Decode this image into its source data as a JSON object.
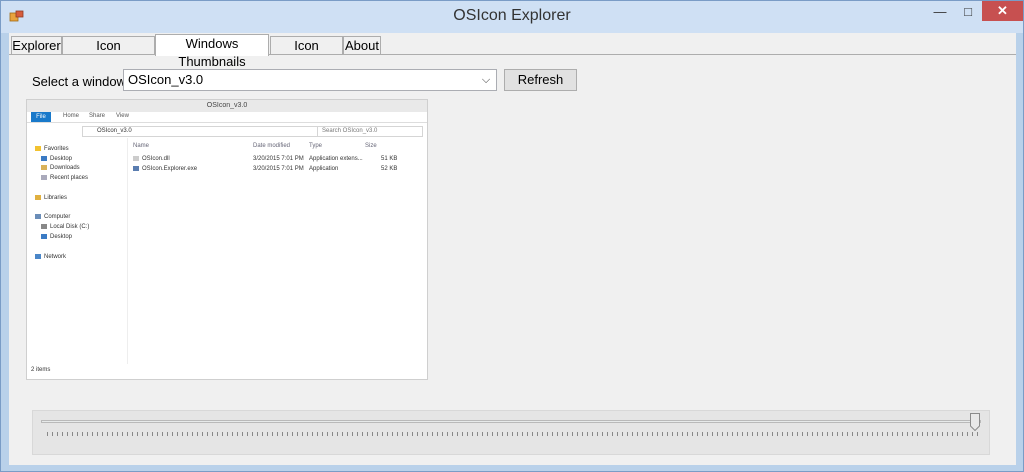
{
  "window": {
    "title": "OSIcon Explorer"
  },
  "tabs": [
    {
      "label": "Explorer"
    },
    {
      "label": "Icon Associations"
    },
    {
      "label": "Windows Thumbnails"
    },
    {
      "label": "Icon Explorer"
    },
    {
      "label": "About"
    }
  ],
  "panel": {
    "select_label": "Select a window:",
    "selected_window": "OSIcon_v3.0",
    "refresh_label": "Refresh"
  },
  "thumbnail": {
    "title": "OSIcon_v3.0",
    "ribbon": [
      "File",
      "Home",
      "Share",
      "View"
    ],
    "address": "OSIcon_v3.0",
    "search_placeholder": "Search OSIcon_v3.0",
    "nav": {
      "favorites": "Favorites",
      "desktop": "Desktop",
      "downloads": "Downloads",
      "recent": "Recent places",
      "libraries": "Libraries",
      "computer": "Computer",
      "local_disk": "Local Disk (C:)",
      "desktop2": "Desktop",
      "network": "Network"
    },
    "columns": [
      "Name",
      "Date modified",
      "Type",
      "Size"
    ],
    "files": [
      {
        "name": "OSIcon.dll",
        "date": "3/20/2015 7:01 PM",
        "type": "Application extens...",
        "size": "51 KB"
      },
      {
        "name": "OSIcon.Explorer.exe",
        "date": "3/20/2015 7:01 PM",
        "type": "Application",
        "size": "52 KB"
      }
    ],
    "status": "2 items"
  },
  "slider": {
    "value_fraction": 1.0
  },
  "colors": {
    "close": "#c75050",
    "title_bg": "#cfe0f4",
    "file_tab": "#1979ca"
  }
}
